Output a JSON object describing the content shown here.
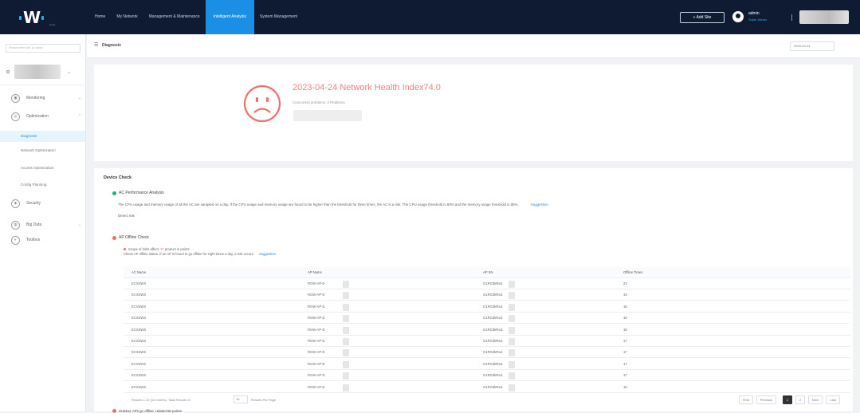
{
  "topbar": {
    "logo_text": "Ruijie",
    "nav": [
      "Home",
      "My Network",
      "Management & Maintenance",
      "Intelligent Analysis",
      "System Management"
    ],
    "active_nav_index": 3,
    "add_site": "+ Add Site",
    "user_name": "admin",
    "user_role": "Super Admin"
  },
  "sidebar": {
    "search_placeholder": "Please enter site, ip, name",
    "menu": [
      {
        "label": "Monitoring",
        "icon": "monitor-icon",
        "chevron": "⌄"
      },
      {
        "label": "Optimization",
        "icon": "optimize-icon",
        "chevron": "⌃"
      }
    ],
    "sub_items": [
      "Diagnosis",
      "Network Optimization",
      "Access Optimization",
      "Config Planning"
    ],
    "active_sub_index": 0,
    "menu2": [
      {
        "label": "Security",
        "icon": "security-icon",
        "chevron": ""
      },
      {
        "label": "Big Data",
        "icon": "bigdata-icon",
        "chevron": "⌄"
      },
      {
        "label": "Toolbox",
        "icon": "toolbox-icon",
        "chevron": ""
      }
    ]
  },
  "main": {
    "page_title": "Diagnosis",
    "date": "2023-04-24",
    "health_title": "2023-04-24 Network Health Index74.0",
    "health_sub": "Concurrent problems: 3 Problems"
  },
  "device_check": {
    "title": "Device Check",
    "ac_check": "AC Performance Analysis",
    "ac_desc": "The CPU usage and memory usage of all the AC are sampled on a day. If the CPU usage and memory usage are found to be higher than the threshold for three times, the AC is a risk. The CPU usage threshold is 80% and the memory usage threshold is 85%.",
    "ac_link": "Suggestion",
    "detect_text": "Detect risk",
    "ap_check": "AP Offline Check",
    "impact_prefix": "Scope of risks affect:",
    "impact_num": "17",
    "impact_suffix": "product in points",
    "impact_detail": "Check AP offline status. If an AP is found to go offline for eight times a day, a risk occurs.",
    "impact_link": "Suggestion",
    "columns": [
      "AC Name",
      "AP Name",
      "AP SN",
      "Offline Times"
    ],
    "rows": [
      [
        "ECSSWS",
        "RGW-AP-D",
        "G1RG3kRw1",
        "23"
      ],
      [
        "ECSSWS",
        "RGW-AP-D",
        "G1RG3kRw1",
        "19"
      ],
      [
        "ECSSWS",
        "RGW-AP-D",
        "G1RG3kRw1",
        "18"
      ],
      [
        "ECSSWS",
        "RGW-AP-D",
        "G1RG3kRw1",
        "18"
      ],
      [
        "ECSSWS",
        "RGW-AP-D",
        "G1RG3kRw1",
        "18"
      ],
      [
        "ECSSWS",
        "RGW-AP-D",
        "G1RG3kRw1",
        "17"
      ],
      [
        "ECSSWS",
        "RGW-AP-D",
        "G1RG3kRw1",
        "17"
      ],
      [
        "ECSSWS",
        "RGW-AP-D",
        "G1RG3kRw1",
        "17"
      ],
      [
        "ECSSWS",
        "RGW-AP-D",
        "G1RG3kRw1",
        "17"
      ],
      [
        "ECSSWS",
        "RGW-AP-D",
        "G1RG3kRw1",
        "15"
      ]
    ],
    "pager_info": "Results 1-10 (10 entries), Total Results 17",
    "page_size": "10",
    "page_size_label": "Results Per Page",
    "pages": [
      "First",
      "Previous",
      "1",
      "2",
      "Next",
      "Last"
    ],
    "active_page": "1",
    "next_check": "Outdoor APs go offline, related 50 points"
  }
}
